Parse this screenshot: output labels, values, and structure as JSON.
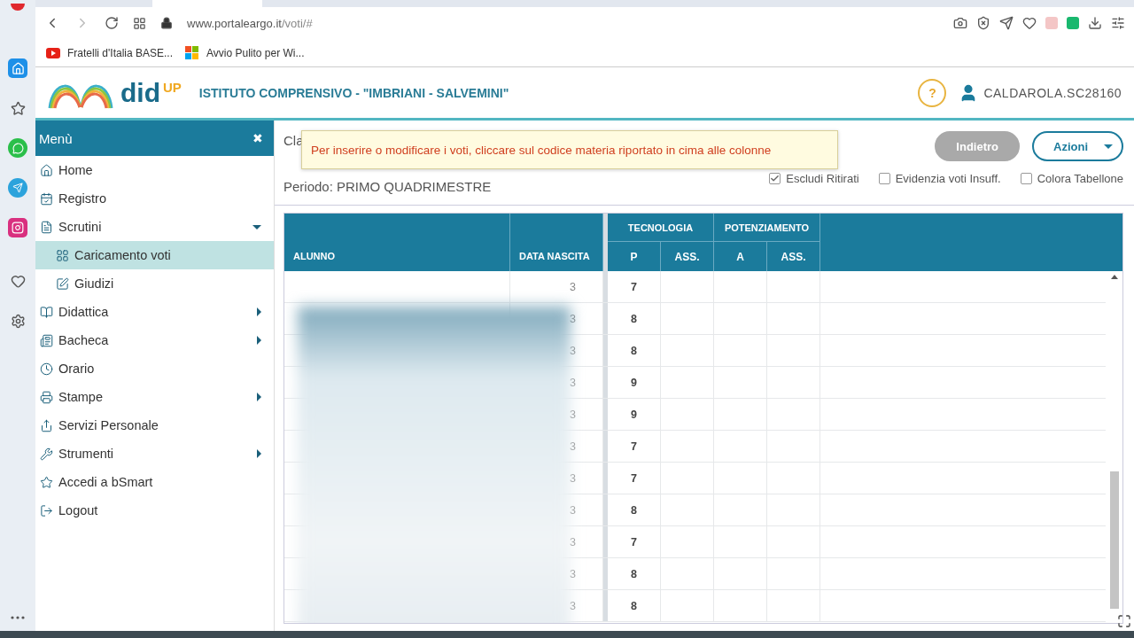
{
  "browser": {
    "url_host": "www.portaleargo.it",
    "url_path": "/voti/#",
    "bookmarks": [
      {
        "label": "Fratelli d'Italia BASE..."
      },
      {
        "label": "Avvio Pulito per Wi..."
      }
    ]
  },
  "app": {
    "brand": "did",
    "brand_sup": "UP",
    "school": "ISTITUTO COMPRENSIVO - \"IMBRIANI - SALVEMINI\"",
    "help": "?",
    "user": "CALDAROLA.SC28160"
  },
  "menu": {
    "title": "Menù",
    "close": "✖",
    "items": [
      {
        "label": "Home",
        "selected": false
      },
      {
        "label": "Registro",
        "selected": false
      },
      {
        "label": "Scrutini",
        "selected": false,
        "expanded": true,
        "children": [
          {
            "label": "Caricamento voti",
            "selected": true
          },
          {
            "label": "Giudizi",
            "selected": false
          }
        ]
      },
      {
        "label": "Didattica",
        "selected": false,
        "expanded": false
      },
      {
        "label": "Bacheca",
        "selected": false,
        "expanded": false
      },
      {
        "label": "Orario",
        "selected": false
      },
      {
        "label": "Stampe",
        "selected": false,
        "expanded": false
      },
      {
        "label": "Servizi Personale",
        "selected": false
      },
      {
        "label": "Strumenti",
        "selected": false,
        "expanded": false
      },
      {
        "label": "Accedi a bSmart",
        "selected": false
      },
      {
        "label": "Logout",
        "selected": false
      }
    ]
  },
  "content": {
    "class_label": "Cla",
    "period": "Periodo: PRIMO QUADRIMESTRE",
    "tooltip": "Per inserire o modificare i voti, cliccare sul codice materia riportato in cima alle colonne",
    "buttons": [
      {
        "label": "Indietro",
        "disabled": true,
        "kind": "plain"
      },
      {
        "label": "Azioni",
        "disabled": false,
        "kind": "dropdown"
      }
    ],
    "options": [
      {
        "label": "Escludi Ritirati",
        "checked": true
      },
      {
        "label": "Evidenzia voti Insuff.",
        "checked": false
      },
      {
        "label": "Colora Tabellone",
        "checked": false
      }
    ]
  },
  "table": {
    "columns": [
      "ALUNNO",
      "DATA NASCITA"
    ],
    "subjects": [
      {
        "name": "TECNOLOGIA",
        "subcolumns": [
          "P",
          "ASS."
        ]
      },
      {
        "name": "POTENZIAMENTO",
        "subcolumns": [
          "A",
          "ASS."
        ]
      }
    ],
    "rows": [
      {
        "date": "3",
        "grade": "7"
      },
      {
        "date": "3",
        "grade": "8"
      },
      {
        "date": "3",
        "grade": "8"
      },
      {
        "date": "3",
        "grade": "9"
      },
      {
        "date": "3",
        "grade": "9"
      },
      {
        "date": "3",
        "grade": "7"
      },
      {
        "date": "3",
        "grade": "7"
      },
      {
        "date": "3",
        "grade": "8"
      },
      {
        "date": "3",
        "grade": "7"
      },
      {
        "date": "3",
        "grade": "8"
      },
      {
        "date": "3",
        "grade": "8"
      }
    ]
  }
}
